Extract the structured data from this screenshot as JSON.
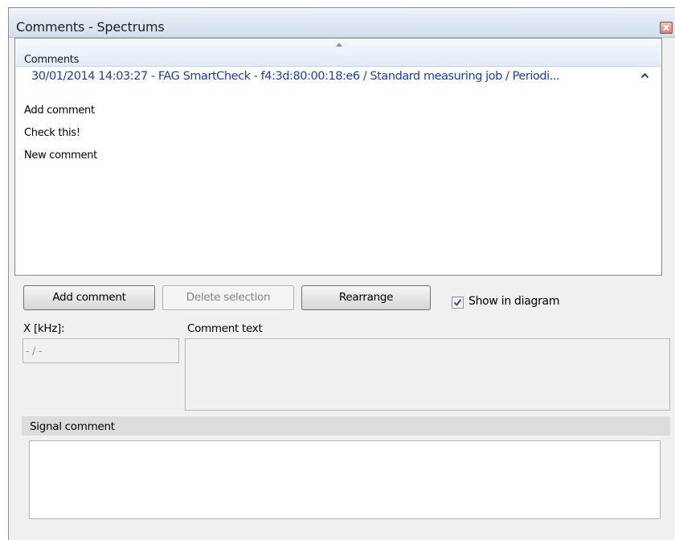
{
  "window": {
    "title": "Comments - Spectrums"
  },
  "comments_list": {
    "header": "Comments",
    "group_title": "30/01/2014 14:03:27 - FAG SmartCheck - f4:3d:80:00:18:e6 / Standard measuring job / Periodi...",
    "items": [
      "Add comment",
      "Check this!",
      "New comment"
    ]
  },
  "buttons": {
    "add": "Add comment",
    "delete": "Delete selection",
    "rearrange": "Rearrange"
  },
  "show_in_diagram": {
    "label": "Show in diagram",
    "checked": true
  },
  "x_field": {
    "label": "X [kHz]:",
    "value": "- / -"
  },
  "comment_text": {
    "label": "Comment text",
    "value": ""
  },
  "signal_comment": {
    "label": "Signal comment",
    "value": ""
  },
  "icons": [
    "close-icon",
    "sort-ascending-icon",
    "collapse-icon",
    "checkmark-icon"
  ],
  "colors": {
    "group_title": "#1b3fad",
    "header_gradient_top": "#f4f9fe",
    "background": "#f0f0f0"
  }
}
